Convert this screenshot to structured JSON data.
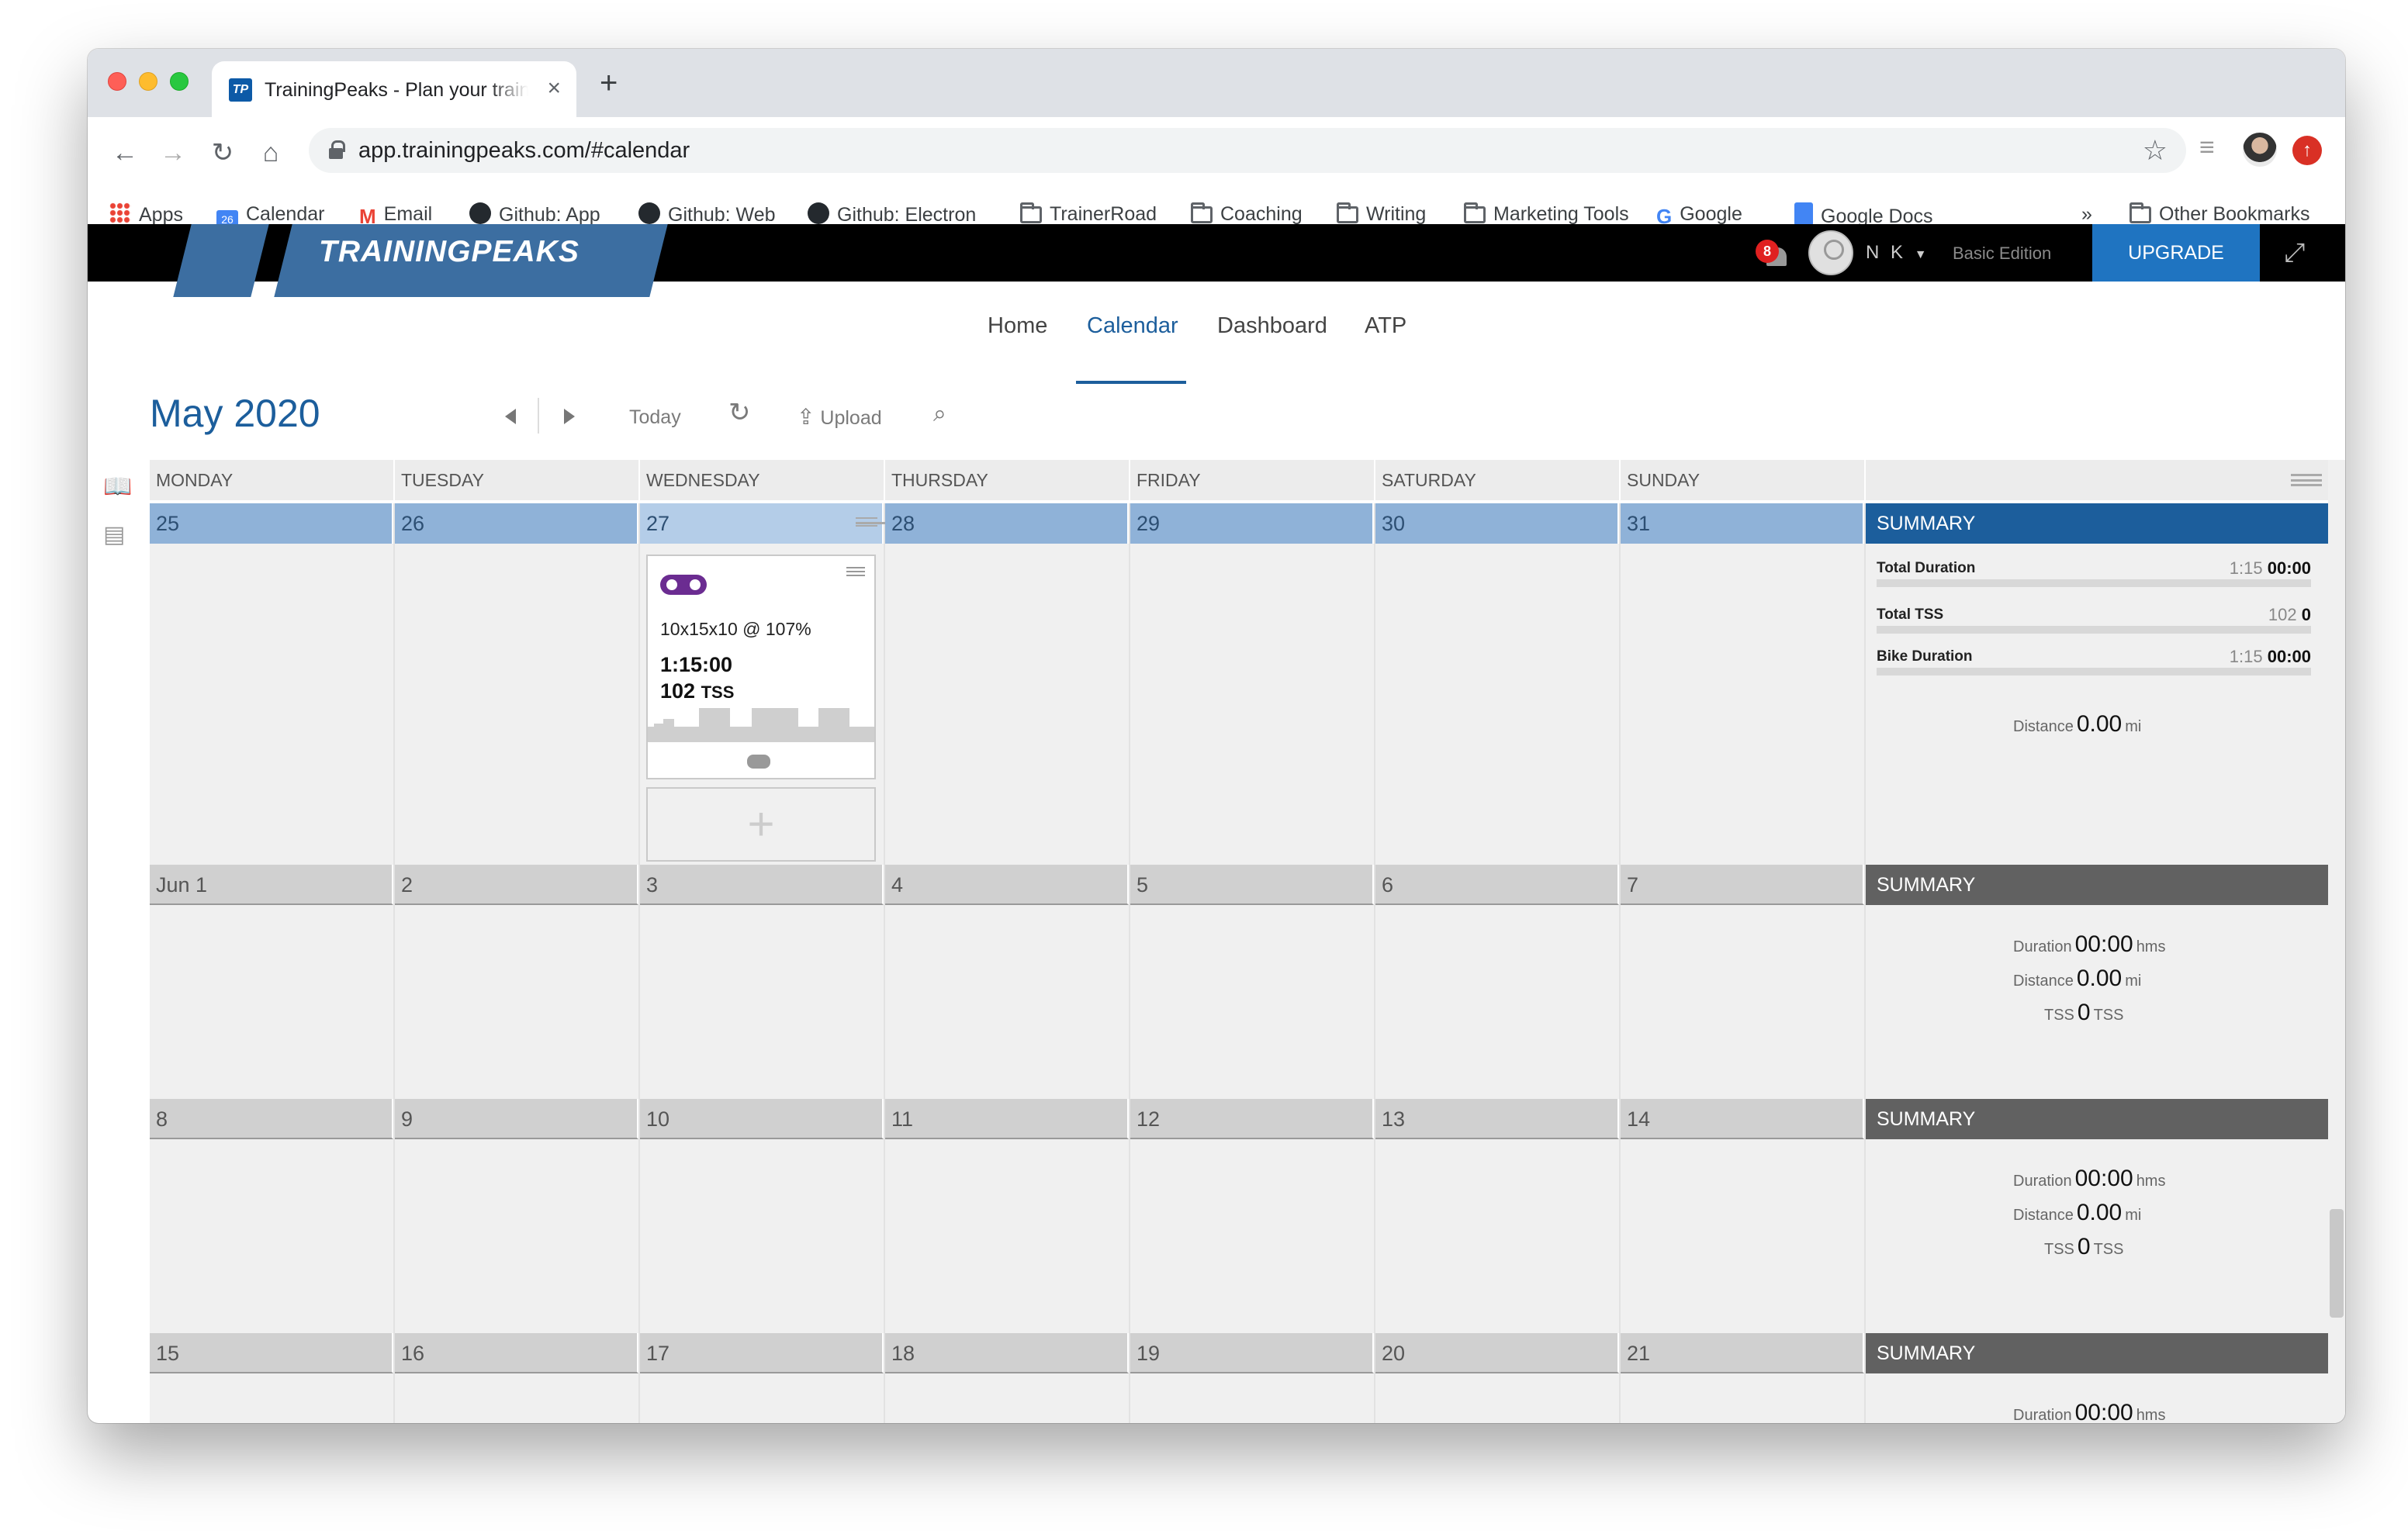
{
  "browser": {
    "tab_title": "TrainingPeaks - Plan your training",
    "tab_favicon": "TP",
    "url": "app.trainingpeaks.com/#calendar",
    "bookmarks": [
      {
        "label": "Apps",
        "icon": "apps-grid-icon"
      },
      {
        "label": "Calendar",
        "icon": "google-calendar-icon"
      },
      {
        "label": "Email",
        "icon": "gmail-icon"
      },
      {
        "label": "Github: App",
        "icon": "github-icon"
      },
      {
        "label": "Github: Web",
        "icon": "github-icon"
      },
      {
        "label": "Github: Electron",
        "icon": "github-icon"
      },
      {
        "label": "TrainerRoad",
        "icon": "folder-icon"
      },
      {
        "label": "Coaching",
        "icon": "folder-icon"
      },
      {
        "label": "Writing",
        "icon": "folder-icon"
      },
      {
        "label": "Marketing Tools",
        "icon": "folder-icon"
      },
      {
        "label": "Google",
        "icon": "google-icon"
      },
      {
        "label": "Google Docs",
        "icon": "google-docs-icon"
      }
    ],
    "overflow": "»",
    "other_bookmarks": "Other Bookmarks"
  },
  "header": {
    "logo": "TRAININGPEAKS",
    "notification_count": "8",
    "user_initials": "N K",
    "edition": "Basic Edition",
    "upgrade_label": "UPGRADE"
  },
  "nav": {
    "home": "Home",
    "calendar": "Calendar",
    "dashboard": "Dashboard",
    "atp": "ATP",
    "active": "Calendar"
  },
  "calendar": {
    "month": "May",
    "year": "2020",
    "today_label": "Today",
    "upload_label": "Upload",
    "days": [
      "MONDAY",
      "TUESDAY",
      "WEDNESDAY",
      "THURSDAY",
      "FRIDAY",
      "SATURDAY",
      "SUNDAY"
    ],
    "weeks": [
      {
        "dates": [
          "25",
          "26",
          "27",
          "28",
          "29",
          "30",
          "31"
        ]
      },
      {
        "dates": [
          "Jun 1",
          "2",
          "3",
          "4",
          "5",
          "6",
          "7"
        ]
      },
      {
        "dates": [
          "8",
          "9",
          "10",
          "11",
          "12",
          "13",
          "14"
        ]
      },
      {
        "dates": [
          "15",
          "16",
          "17",
          "18",
          "19",
          "20",
          "21"
        ]
      }
    ],
    "summary_label": "SUMMARY",
    "week1_summary": {
      "total_duration_label": "Total Duration",
      "total_duration_planned": "1:15",
      "total_duration_completed": "00:00",
      "total_tss_label": "Total TSS",
      "total_tss_planned": "102",
      "total_tss_completed": "0",
      "bike_duration_label": "Bike Duration",
      "bike_duration_planned": "1:15",
      "bike_duration_completed": "00:00",
      "distance_label": "Distance",
      "distance_value": "0.00",
      "distance_unit": "mi"
    },
    "empty_summary": {
      "duration_label": "Duration",
      "duration_value": "00:00",
      "duration_unit": "hms",
      "distance_label": "Distance",
      "distance_value": "0.00",
      "distance_unit": "mi",
      "tss_label": "TSS",
      "tss_value": "0",
      "tss_unit": "TSS"
    },
    "workout": {
      "title": "10x15x10 @ 107%",
      "duration": "1:15:00",
      "tss_value": "102",
      "tss_unit": "TSS",
      "sport_icon": "bike-icon"
    }
  },
  "colors": {
    "accent": "#1c5e9c",
    "upgrade": "#1f74c1",
    "week_current": "#8fb2d8",
    "workout_bike": "#6b2c91"
  }
}
